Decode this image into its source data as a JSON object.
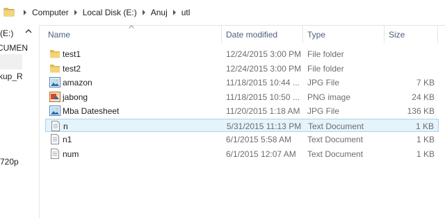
{
  "address_bar": {
    "crumbs": [
      "Computer",
      "Local Disk (E:)",
      "Anuj",
      "utl"
    ]
  },
  "nav_pane": {
    "items": [
      "(E:)",
      "CUMEN",
      "kup_R",
      "720p"
    ]
  },
  "columns": {
    "name": "Name",
    "date": "Date modified",
    "type": "Type",
    "size": "Size"
  },
  "files": [
    {
      "name": "test1",
      "date": "12/24/2015 3:00 PM",
      "type": "File folder",
      "size": "",
      "icon": "folder-icon"
    },
    {
      "name": "test2",
      "date": "12/24/2015 3:00 PM",
      "type": "File folder",
      "size": "",
      "icon": "folder-icon"
    },
    {
      "name": "amazon",
      "date": "11/18/2015 10:44 ...",
      "type": "JPG File",
      "size": "7 KB",
      "icon": "image-file-icon"
    },
    {
      "name": "jabong",
      "date": "11/18/2015 10:50 ...",
      "type": "PNG image",
      "size": "24 KB",
      "icon": "png-file-icon"
    },
    {
      "name": "Mba Datesheet",
      "date": "11/20/2015 1:18 AM",
      "type": "JPG File",
      "size": "136 KB",
      "icon": "image-file-icon"
    },
    {
      "name": "n",
      "date": "5/31/2015 11:13 PM",
      "type": "Text Document",
      "size": "1 KB",
      "icon": "text-file-icon",
      "selected": true
    },
    {
      "name": "n1",
      "date": "6/1/2015 5:58 AM",
      "type": "Text Document",
      "size": "1 KB",
      "icon": "text-file-icon"
    },
    {
      "name": "num",
      "date": "6/1/2015 12:07 AM",
      "type": "Text Document",
      "size": "1 KB",
      "icon": "text-file-icon"
    }
  ],
  "colors": {
    "selection_bg": "#e5f3fb",
    "selection_border": "#a8d2ec",
    "header_text": "#4c607a",
    "folder_yellow": "#e8c05a"
  }
}
